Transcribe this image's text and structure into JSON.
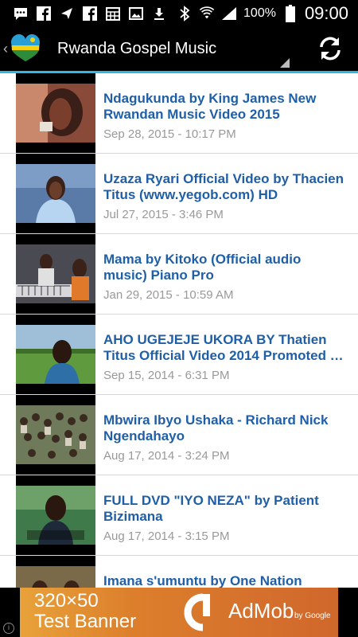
{
  "status_bar": {
    "battery_percent": "100%",
    "time": "09:00"
  },
  "action_bar": {
    "title": "Rwanda Gospel Music"
  },
  "videos": [
    {
      "title": "Ndagukunda by King James New Rwandan Music Video 2015",
      "date": "Sep 28, 2015 - 10:17 PM"
    },
    {
      "title": "Uzaza Ryari Official Video by Thacien Titus (www.yegob.com) HD",
      "date": "Jul 27, 2015 - 3:46 PM"
    },
    {
      "title": "Mama by Kitoko (Official audio music) Piano Pro",
      "date": "Jan 29, 2015 - 10:59 AM"
    },
    {
      "title": "AHO UGEJEJE UKORA BY Thatien Titus Official Video 2014 Promoted …",
      "date": "Sep 15, 2014 - 6:31 PM"
    },
    {
      "title": "Mbwira Ibyo Ushaka - Richard Nick Ngendahayo",
      "date": "Aug 17, 2014 - 3:24 PM"
    },
    {
      "title": "FULL DVD \"IYO NEZA\" by Patient Bizimana",
      "date": "Aug 17, 2014 - 3:15 PM"
    },
    {
      "title": "Imana s'umuntu by One Nation",
      "date": ""
    }
  ],
  "ad": {
    "line1": "320×50",
    "line2": "Test Banner",
    "brand": "AdMob",
    "by": "by Google"
  }
}
